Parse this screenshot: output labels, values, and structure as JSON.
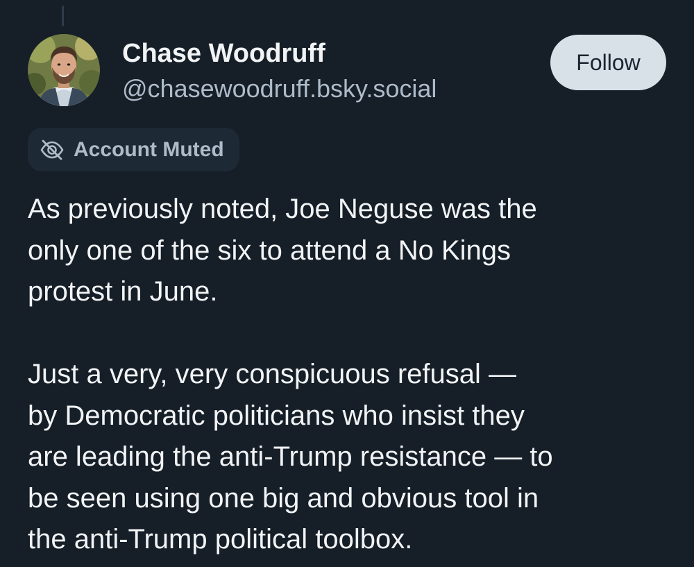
{
  "author": {
    "display_name": "Chase Woodruff",
    "handle": "@chasewoodruff.bsky.social",
    "avatar_icon": "profile-photo"
  },
  "follow_button": {
    "label": "Follow"
  },
  "muted_badge": {
    "icon": "eye-slash-icon",
    "label": "Account Muted"
  },
  "post": {
    "paragraphs": [
      {
        "lines": [
          "As previously noted, Joe Neguse was the",
          "only one of the six to attend a No Kings",
          "protest in June."
        ]
      },
      {
        "lines": [
          "Just a very, very conspicuous refusal —",
          "by Democratic politicians who insist they",
          "are leading the anti-Trump resistance — to",
          "be seen using one big and obvious tool in",
          "the anti-Trump political toolbox."
        ]
      }
    ]
  },
  "colors": {
    "background": "#161e27",
    "text": "#f1f3f5",
    "secondary_text": "#aebbc9",
    "button_bg": "#d8e0e8"
  }
}
